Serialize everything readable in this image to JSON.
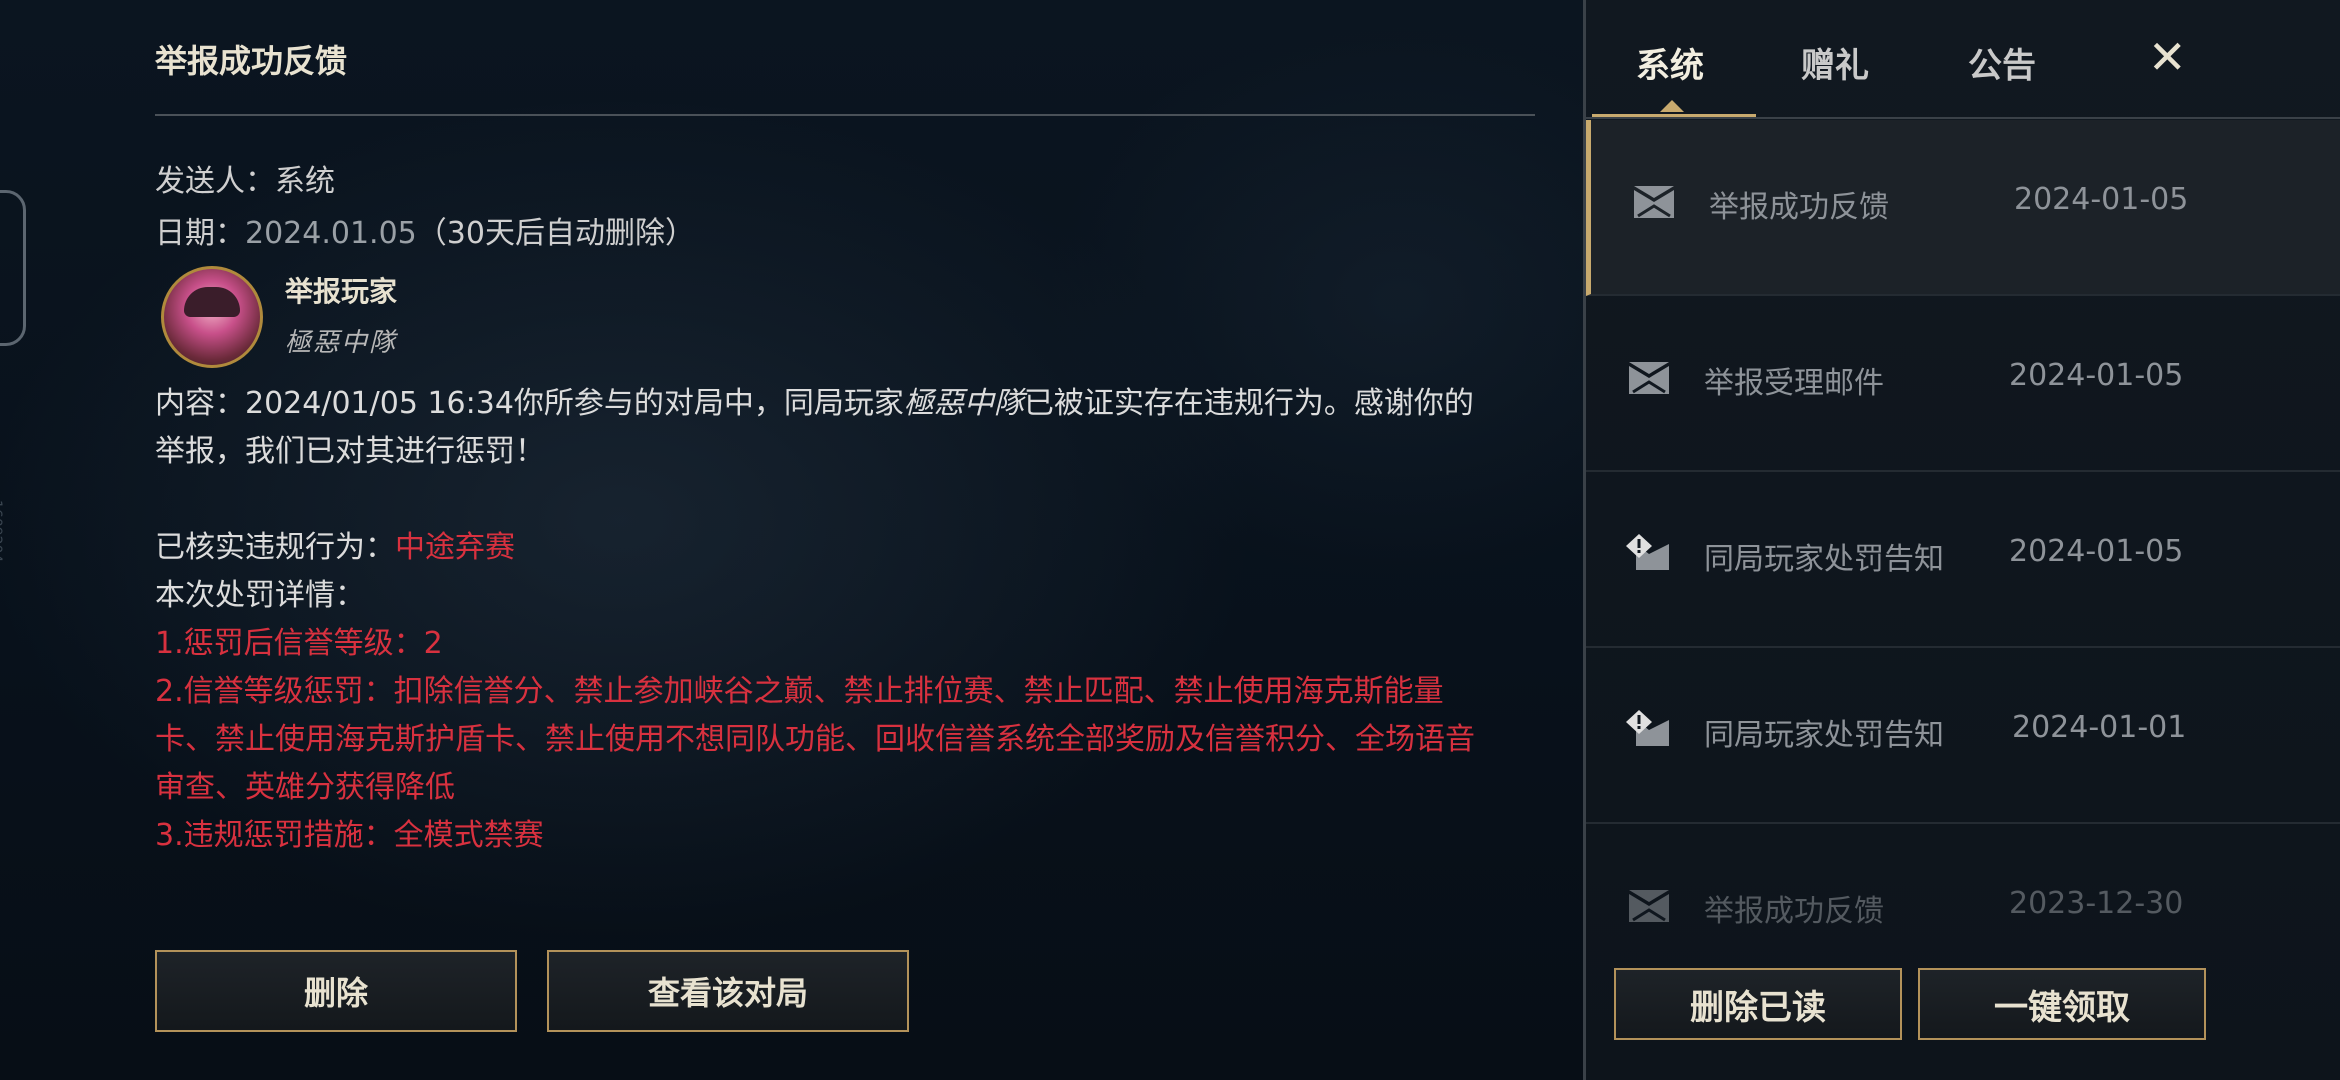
{
  "mail": {
    "title": "举报成功反馈",
    "sender_label": "发送人：",
    "sender_value": "系统",
    "date_label": "日期：",
    "date_value": "2024.01.05",
    "date_note": "（30天后自动删除）",
    "player_label": "举报玩家",
    "player_name": "極惡中隊",
    "content_label": "内容：",
    "content_text_1": "2024/01/05 16:34你所参与的对局中，同局玩家",
    "content_player": "極惡中隊",
    "content_text_2": "已被证实存在违规行为。感谢你的举报，我们已对其进行惩罚！",
    "verified_label": "已核实违规行为：",
    "verified_value": "中途弃赛",
    "details_label": "本次处罚详情：",
    "detail_1": "1.惩罚后信誉等级：2",
    "detail_2": "2.信誉等级惩罚：扣除信誉分、禁止参加峡谷之巅、禁止排位赛、禁止匹配、禁止使用海克斯能量卡、禁止使用海克斯护盾卡、禁止使用不想同队功能、回收信誉系统全部奖励及信誉积分、全场语音审查、英雄分获得降低",
    "detail_3": "3.违规惩罚措施：全模式禁赛",
    "delete_button": "删除",
    "view_match_button": "查看该对局"
  },
  "side_id": "1609204",
  "tabs": {
    "system": "系统",
    "gift": "赠礼",
    "notice": "公告",
    "close_symbol": "✕"
  },
  "mail_list": [
    {
      "title": "举报成功反馈",
      "date": "2024-01-05",
      "icon": "envelope-icon"
    },
    {
      "title": "举报受理邮件",
      "date": "2024-01-05",
      "icon": "envelope-icon"
    },
    {
      "title": "同局玩家处罚告知",
      "date": "2024-01-05",
      "icon": "warning-envelope-icon"
    },
    {
      "title": "同局玩家处罚告知",
      "date": "2024-01-01",
      "icon": "warning-envelope-icon"
    },
    {
      "title": "举报成功反馈",
      "date": "2023-12-30",
      "icon": "envelope-icon"
    }
  ],
  "footer": {
    "delete_read": "删除已读",
    "claim_all": "一键领取"
  },
  "colors": {
    "accent_gold": "#c8aa6e",
    "penalty_red": "#d8313f"
  }
}
